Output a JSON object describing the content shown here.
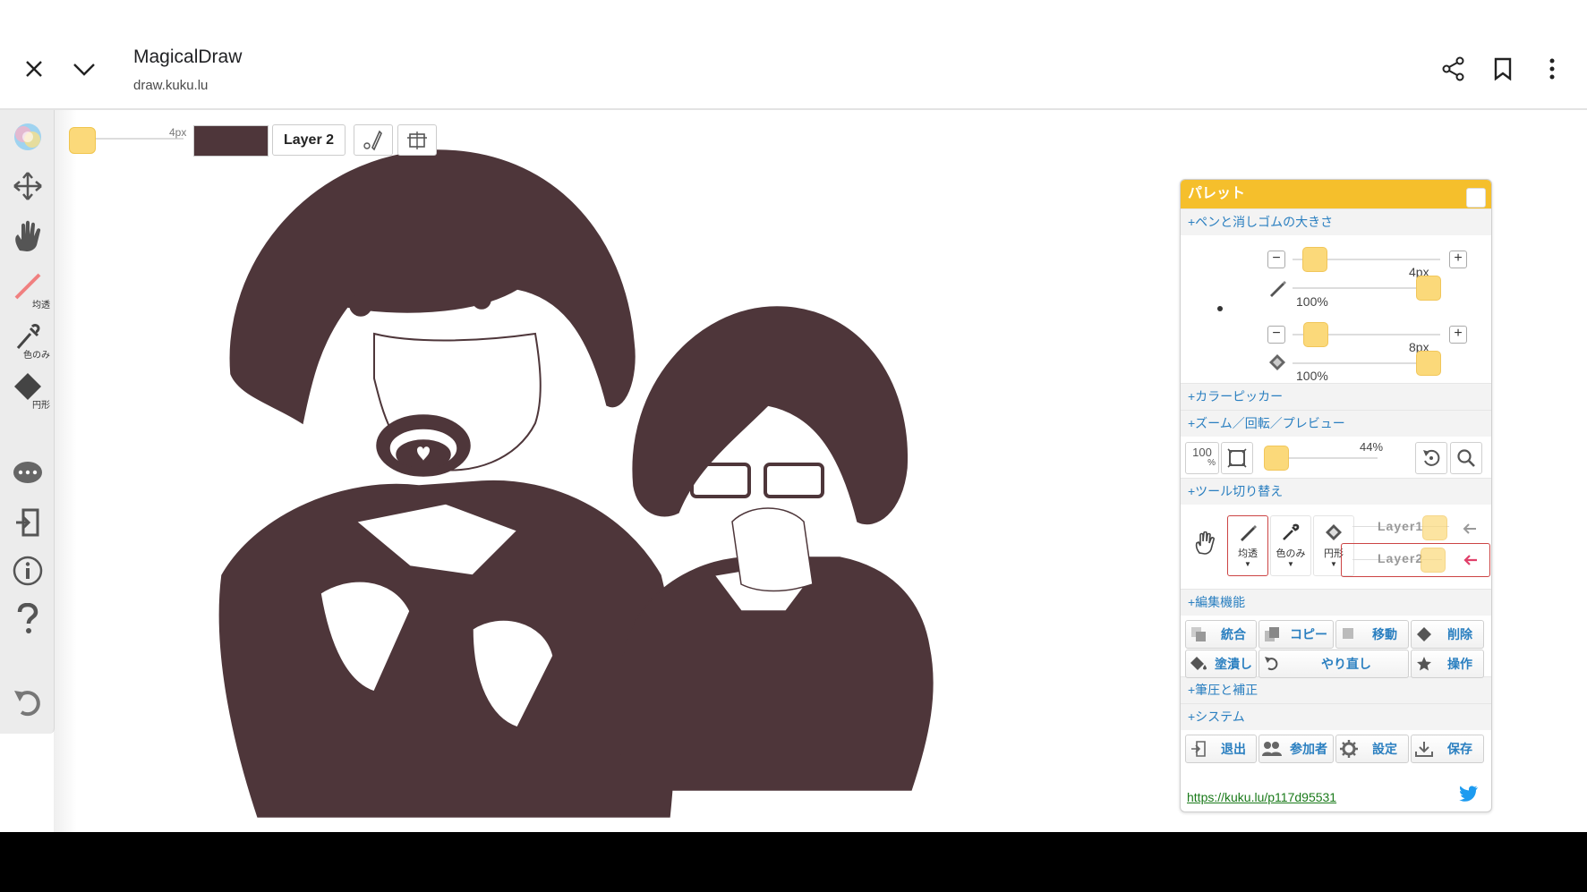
{
  "header": {
    "title": "MagicalDraw",
    "url": "draw.kuku.lu"
  },
  "toolbar": {
    "size_label": "4px",
    "layer_label": "Layer 2",
    "color": "#4e363a"
  },
  "tools": [
    {
      "name": "color-wheel",
      "label": ""
    },
    {
      "name": "move",
      "label": ""
    },
    {
      "name": "hand",
      "label": ""
    },
    {
      "name": "pen",
      "label": "均透"
    },
    {
      "name": "eyedropper",
      "label": "色のみ"
    },
    {
      "name": "eraser",
      "label": "円形"
    }
  ],
  "palette": {
    "title": "パレット",
    "sec_pen_size": "+ペンと消しゴムの大きさ",
    "pen_size": "4px",
    "pen_opacity": "100%",
    "eraser_size": "8px",
    "eraser_opacity": "100%",
    "sec_color_picker": "+カラーピッカー",
    "sec_zoom": "+ズーム／回転／プレビュー",
    "zoom_100": "100",
    "zoom_pct_sym": "%",
    "zoom_value": "44%",
    "sec_tool_switch": "+ツール切り替え",
    "tool_pen_label": "均透",
    "tool_eyedropper_label": "色のみ",
    "tool_eraser_label": "円形",
    "arrow_glyph": "▼",
    "layer1": "Layer1",
    "layer2": "Layer2",
    "sec_edit": "+編集機能",
    "btn_merge": "統合",
    "btn_copy": "コピー",
    "btn_move": "移動",
    "btn_delete": "削除",
    "btn_fill": "塗潰し",
    "btn_redo": "やり直し",
    "btn_operation": "操作",
    "sec_brush": "+筆圧と補正",
    "sec_system": "+システム",
    "btn_exit": "退出",
    "btn_members": "参加者",
    "btn_settings": "設定",
    "btn_save": "保存",
    "share_url": "https://kuku.lu/p117d95531"
  },
  "colors": {
    "accent": "#f5bf2c",
    "knob": "#fbd97a",
    "link": "#2a7fc0",
    "ink": "#4e363a"
  }
}
